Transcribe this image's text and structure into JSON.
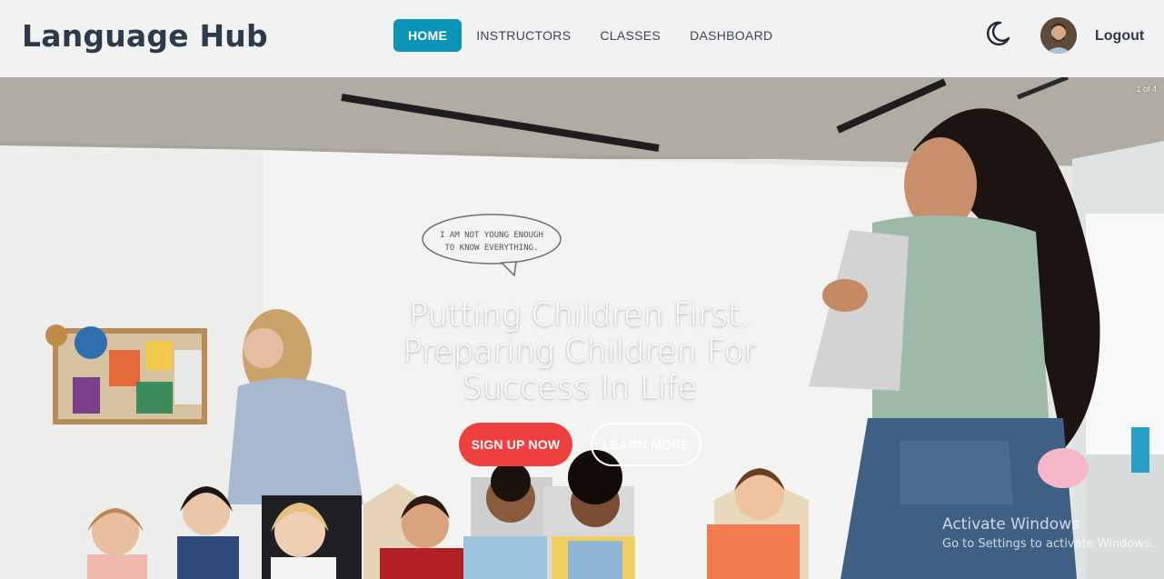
{
  "brand": "Language Hub",
  "nav": {
    "items": [
      {
        "label": "HOME",
        "active": true
      },
      {
        "label": "INSTRUCTORS",
        "active": false
      },
      {
        "label": "CLASSES",
        "active": false
      },
      {
        "label": "DASHBOARD",
        "active": false
      }
    ],
    "theme_icon": "moon-icon",
    "logout_label": "Logout"
  },
  "hero": {
    "slide_counter": "1 of 4",
    "headline_line1": "Putting Children First.",
    "headline_line2": "Preparing Children For",
    "headline_line3": "Success In Life",
    "signup_label": "SIGN UP NOW",
    "learn_label": "LEARN MORE",
    "speech_bubble_text": "I AM NOT YOUNG ENOUGH TO KNOW EVERYTHING."
  },
  "watermark": {
    "line1": "Activate Windows",
    "line2": "Go to Settings to activate Windows."
  },
  "colors": {
    "accent": "#0b93b8",
    "signup": "#ef4040",
    "brand_text": "#2d3a4b"
  }
}
